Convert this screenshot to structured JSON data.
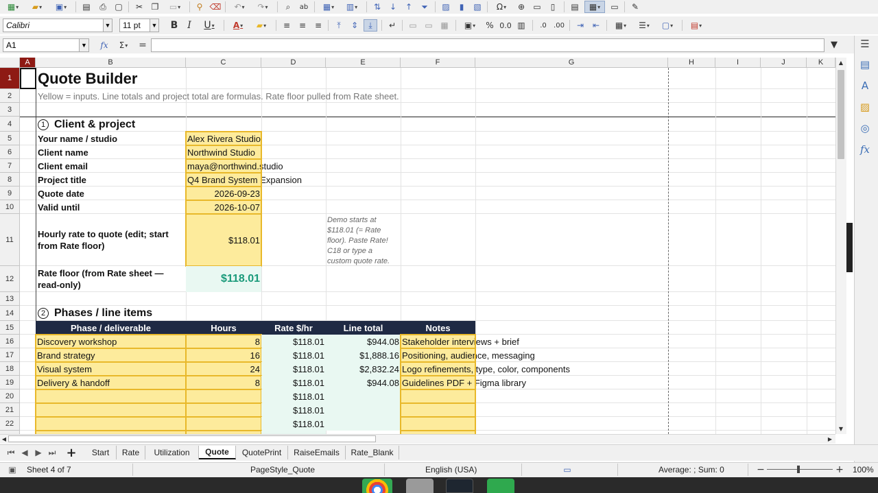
{
  "toolbar": {
    "font_name": "Calibri",
    "font_size": "11 pt",
    "bold_label": "B",
    "italic_label": "I",
    "underline_label": "U",
    "percent_label": "%",
    "decimal_label": "0.0"
  },
  "formula_bar": {
    "cell_ref": "A1",
    "fx_label": "fx",
    "sum_label": "Σ",
    "equals_label": "=",
    "content": ""
  },
  "columns": [
    "A",
    "B",
    "C",
    "D",
    "E",
    "F",
    "G",
    "H",
    "I",
    "J",
    "K"
  ],
  "rows": [
    "1",
    "2",
    "3",
    "4",
    "5",
    "6",
    "7",
    "8",
    "9",
    "10",
    "11",
    "12",
    "13",
    "14",
    "15",
    "16",
    "17",
    "18",
    "19",
    "20",
    "21",
    "22"
  ],
  "sheet": {
    "title": "Quote Builder",
    "subtitle": "Yellow = inputs. Line totals and project total are formulas. Rate floor pulled from Rate sheet.",
    "section1_num": "1",
    "section1_title": "Client & project",
    "fields": [
      {
        "label": "Your name / studio",
        "value": "Alex Rivera Studio"
      },
      {
        "label": "Client name",
        "value": "Northwind Studio"
      },
      {
        "label": "Client email",
        "value": "maya@northwind.studio"
      },
      {
        "label": "Project title",
        "value": "Q4 Brand System Expansion"
      },
      {
        "label": "Quote date",
        "value": "2026-09-23"
      },
      {
        "label": "Valid until",
        "value": "2026-10-07"
      }
    ],
    "hourly_label": "Hourly rate to quote (edit; start from Rate floor)",
    "hourly_value": "$118.01",
    "hourly_note": "Demo starts at $118.01 (= Rate floor). Paste Rate! C18 or type a custom quote rate.",
    "floor_label": "Rate floor (from Rate sheet — read-only)",
    "floor_value": "$118.01",
    "section2_num": "2",
    "section2_title": "Phases / line items",
    "table_headers": [
      "Phase / deliverable",
      "Hours",
      "Rate $/hr",
      "Line total",
      "Notes"
    ],
    "line_items": [
      {
        "phase": "Discovery workshop",
        "hours": "8",
        "rate": "$118.01",
        "total": "$944.08",
        "notes": "Stakeholder interviews + brief"
      },
      {
        "phase": "Brand strategy",
        "hours": "16",
        "rate": "$118.01",
        "total": "$1,888.16",
        "notes": "Positioning, audience, messaging"
      },
      {
        "phase": "Visual system",
        "hours": "24",
        "rate": "$118.01",
        "total": "$2,832.24",
        "notes": "Logo refinements, type, color, components"
      },
      {
        "phase": "Delivery & handoff",
        "hours": "8",
        "rate": "$118.01",
        "total": "$944.08",
        "notes": "Guidelines PDF + Figma library"
      },
      {
        "phase": "",
        "hours": "",
        "rate": "$118.01",
        "total": "",
        "notes": ""
      },
      {
        "phase": "",
        "hours": "",
        "rate": "$118.01",
        "total": "",
        "notes": ""
      },
      {
        "phase": "",
        "hours": "",
        "rate": "$118.01",
        "total": "",
        "notes": ""
      }
    ]
  },
  "tabs": [
    "Start",
    "Rate",
    "Utilization",
    "Quote",
    "QuotePrint",
    "RaiseEmails",
    "Rate_Blank"
  ],
  "active_tab": "Quote",
  "status": {
    "sheet_info": "Sheet 4 of 7",
    "page_style": "PageStyle_Quote",
    "language": "English (USA)",
    "summary": "Average: ; Sum: 0",
    "zoom": "100%"
  },
  "colors": {
    "input_fill": "#fdeb9c",
    "input_border": "#e8b82a",
    "calc_fill": "#e9f8f2",
    "header_fill": "#1f2a44",
    "floor_text": "#1a9a7a",
    "selection": "#8e1a14"
  }
}
